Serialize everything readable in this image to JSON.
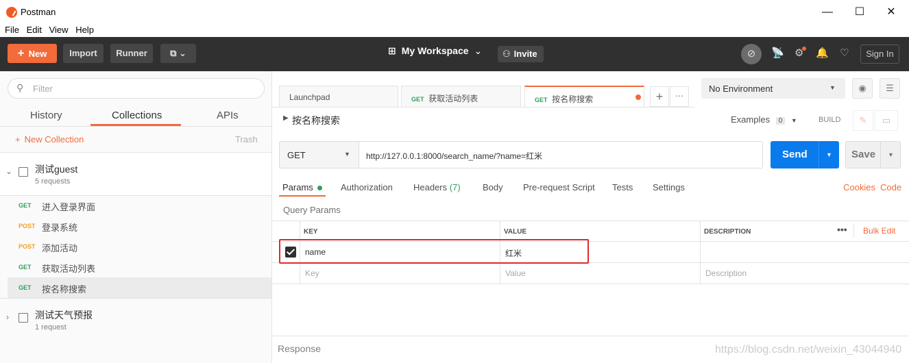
{
  "titlebar": {
    "title": "Postman",
    "minimize": "—",
    "maximize": "☐",
    "close": "✕"
  },
  "menu": [
    "File",
    "Edit",
    "View",
    "Help"
  ],
  "toolbar": {
    "new_label": "New",
    "import_label": "Import",
    "runner_label": "Runner",
    "workspace_label": "My Workspace",
    "invite_label": "Invite",
    "signin_label": "Sign In"
  },
  "sidebar": {
    "filter_placeholder": "Filter",
    "tabs": [
      "History",
      "Collections",
      "APIs"
    ],
    "new_collection": "New Collection",
    "trash": "Trash",
    "collections": [
      {
        "name": "测试guest",
        "count": "5 requests"
      },
      {
        "name": "测试天气预报",
        "count": "1 request"
      }
    ],
    "requests": [
      {
        "method": "GET",
        "name": "进入登录界面"
      },
      {
        "method": "POST",
        "name": "登录系统"
      },
      {
        "method": "POST",
        "name": "添加活动"
      },
      {
        "method": "GET",
        "name": "获取活动列表"
      },
      {
        "method": "GET",
        "name": "按名称搜索"
      }
    ]
  },
  "tabs": [
    {
      "label": "Launchpad"
    },
    {
      "method": "GET",
      "label": "获取活动列表"
    },
    {
      "method": "GET",
      "label": "按名称搜索"
    }
  ],
  "environment": "No Environment",
  "request": {
    "name": "按名称搜索",
    "examples_label": "Examples",
    "examples_count": "0",
    "build_label": "BUILD",
    "method": "GET",
    "url": "http://127.0.0.1:8000/search_name/?name=红米",
    "send_label": "Send",
    "save_label": "Save"
  },
  "param_tabs": [
    {
      "label": "Params"
    },
    {
      "label": "Authorization"
    },
    {
      "label": "Headers",
      "count": "(7)"
    },
    {
      "label": "Body"
    },
    {
      "label": "Pre-request Script"
    },
    {
      "label": "Tests"
    },
    {
      "label": "Settings"
    }
  ],
  "links": {
    "cookies": "Cookies",
    "code": "Code"
  },
  "query_params": {
    "title": "Query Params",
    "headers": {
      "key": "KEY",
      "value": "VALUE",
      "description": "DESCRIPTION",
      "bulk_edit": "Bulk Edit"
    },
    "rows": [
      {
        "key": "name",
        "value": "红米",
        "description": ""
      }
    ],
    "placeholders": {
      "key": "Key",
      "value": "Value",
      "description": "Description"
    }
  },
  "response_label": "Response",
  "watermark": "https://blog.csdn.net/weixin_43044940",
  "colors": {
    "accent": "#f26b3a",
    "send": "#097bed",
    "get": "#2e9f5b",
    "post": "#f4a024",
    "highlight": "#e02a2a"
  }
}
